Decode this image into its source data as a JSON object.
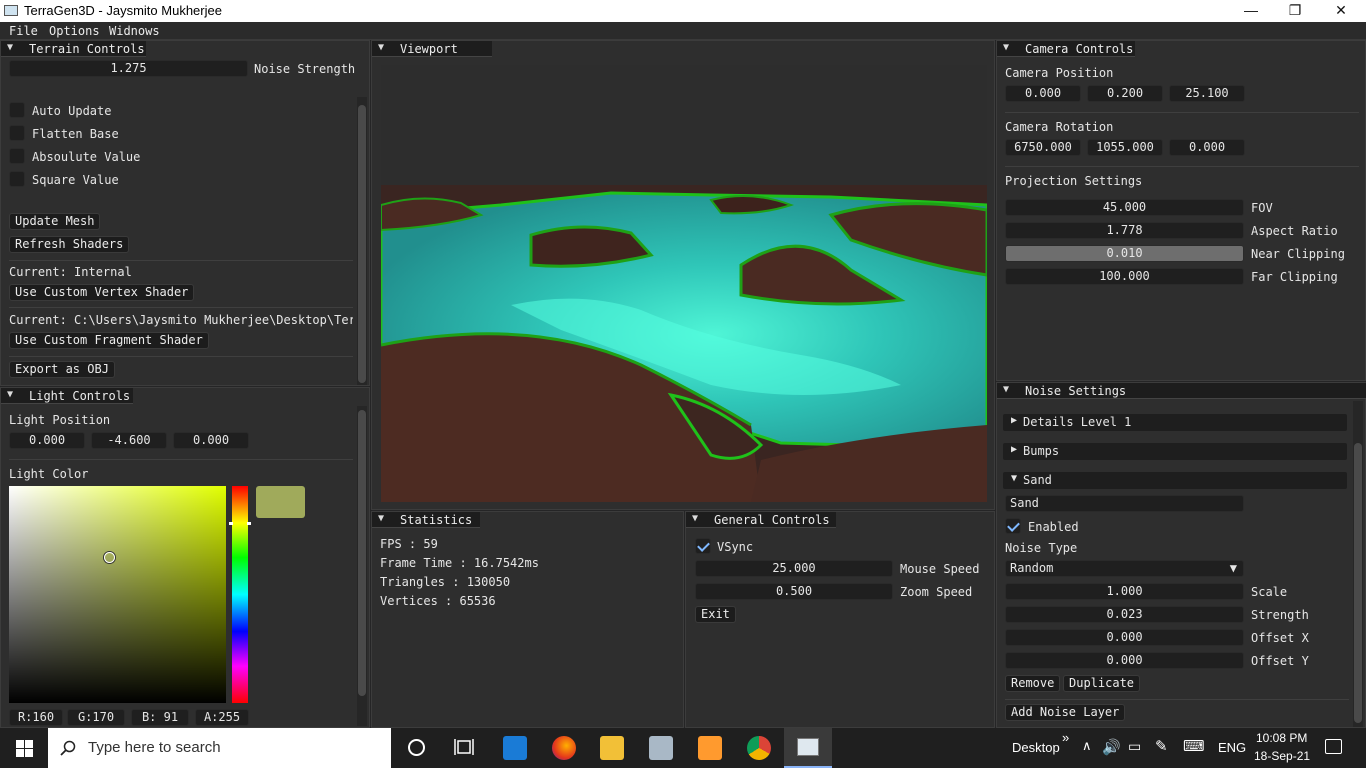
{
  "window": {
    "title": "TerraGen3D - Jaysmito Mukherjee",
    "min": "—",
    "max": "❐",
    "close": "✕"
  },
  "menu": [
    "File",
    "Options",
    "Widnows"
  ],
  "terrain": {
    "title": "Terrain Controls",
    "noise_strength_value": "1.275",
    "noise_strength_label": "Noise Strength",
    "checkboxes": [
      "Auto Update",
      "Flatten Base",
      "Absoulute Value",
      "Square Value"
    ],
    "update_mesh": "Update Mesh",
    "refresh_shaders": "Refresh Shaders",
    "current_vertex": "Current: Internal",
    "use_custom_vertex": "Use Custom Vertex Shader",
    "current_fragment": "Current: C:\\Users\\Jaysmito Mukherjee\\Desktop\\Terr",
    "use_custom_fragment": "Use Custom Fragment Shader",
    "export_obj": "Export as OBJ"
  },
  "light": {
    "title": "Light Controls",
    "position_label": "Light Position",
    "position": [
      "0.000",
      "-4.600",
      "0.000"
    ],
    "color_label": "Light Color",
    "swatch_color": "#a0aa5b",
    "rgba": [
      "R:160",
      "G:170",
      "B: 91",
      "A:255"
    ]
  },
  "viewport": {
    "title": "Viewport"
  },
  "statistics": {
    "title": "Statistics",
    "rows": [
      "FPS         : 59",
      "Frame Time  : 16.7542ms",
      "Triangles  : 130050",
      "Vertices   : 65536"
    ]
  },
  "general": {
    "title": "General Controls",
    "vsync": "VSync",
    "mouse_speed_value": "25.000",
    "mouse_speed_label": "Mouse Speed",
    "zoom_speed_value": "0.500",
    "zoom_speed_label": "Zoom Speed",
    "exit": "Exit"
  },
  "camera": {
    "title": "Camera Controls",
    "position_label": "Camera Position",
    "position": [
      "0.000",
      "0.200",
      "25.100"
    ],
    "rotation_label": "Camera Rotation",
    "rotation": [
      "6750.000",
      "1055.000",
      "0.000"
    ],
    "projection_label": "Projection Settings",
    "fov_value": "45.000",
    "fov_label": "FOV",
    "aspect_value": "1.778",
    "aspect_label": "Aspect Ratio",
    "near_value": "0.010",
    "near_label": "Near Clipping",
    "far_value": "100.000",
    "far_label": "Far Clipping"
  },
  "noise": {
    "title": "Noise Settings",
    "layers": [
      "Details Level 1",
      "Bumps",
      "Sand"
    ],
    "name_value": "Sand",
    "enabled": "Enabled",
    "type_label": "Noise Type",
    "type_value": "Random",
    "scale_value": "1.000",
    "scale_label": "Scale",
    "strength_value": "0.023",
    "strength_label": "Strength",
    "offx_value": "0.000",
    "offx_label": "Offset X",
    "offy_value": "0.000",
    "offy_label": "Offset Y",
    "remove": "Remove",
    "duplicate": "Duplicate",
    "add_layer": "Add Noise Layer"
  },
  "taskbar": {
    "search_placeholder": "Type here to search",
    "desktop": "Desktop",
    "chevron": "»",
    "lang": "ENG",
    "time": "10:08 PM",
    "date": "18-Sep-21"
  }
}
